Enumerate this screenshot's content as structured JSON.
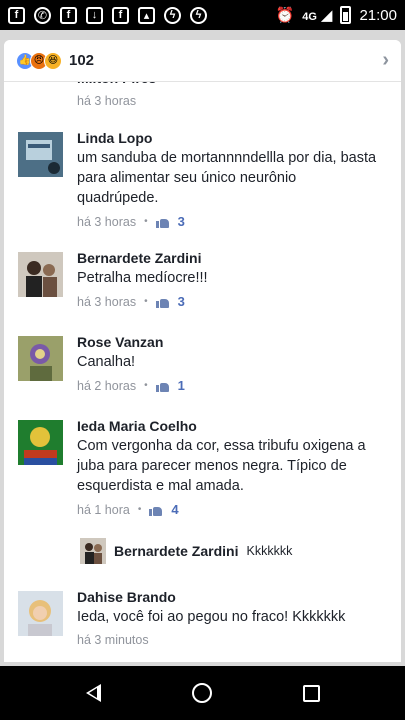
{
  "status": {
    "network": "4G",
    "time": "21:00",
    "icons": [
      "facebook-icon",
      "whatsapp-icon",
      "facebook-icon",
      "download-icon",
      "facebook-icon",
      "gallery-icon",
      "messenger-icon",
      "messenger-icon",
      "alarm-icon"
    ]
  },
  "header": {
    "reaction_count": "102",
    "reactions": [
      "like",
      "angry",
      "haha"
    ]
  },
  "comments": [
    {
      "name": "Milton Pires",
      "text": "",
      "time": "há 3 horas",
      "likes": ""
    },
    {
      "name": "Linda Lopo",
      "text": "um sanduba de  mortannnndellla  por dia, basta para alimentar seu único neurônio quadrúpede.",
      "time": "há 3 horas",
      "likes": "3"
    },
    {
      "name": "Bernardete Zardini",
      "text": "Petralha medíocre!!!",
      "time": "há 3 horas",
      "likes": "3"
    },
    {
      "name": "Rose Vanzan",
      "text": "Canalha!",
      "time": "há 2 horas",
      "likes": "1"
    },
    {
      "name": "Ieda Maria Coelho",
      "text": "Com vergonha da cor, essa tribufu oxigena a juba para parecer menos negra. Típico de esquerdista e mal amada.",
      "time": "há 1 hora",
      "likes": "4"
    },
    {
      "name": "Dahise Brando",
      "text": "Ieda, você foi ao pegou no fraco! Kkkkkkk",
      "time": "há 3 minutos",
      "likes": ""
    }
  ],
  "reply": {
    "name": "Bernardete Zardini",
    "text": "Kkkkkkk"
  },
  "colors": {
    "like": "#5890ff",
    "angry": "#e9710f",
    "haha": "#f7b125",
    "meta": "#90949c"
  }
}
